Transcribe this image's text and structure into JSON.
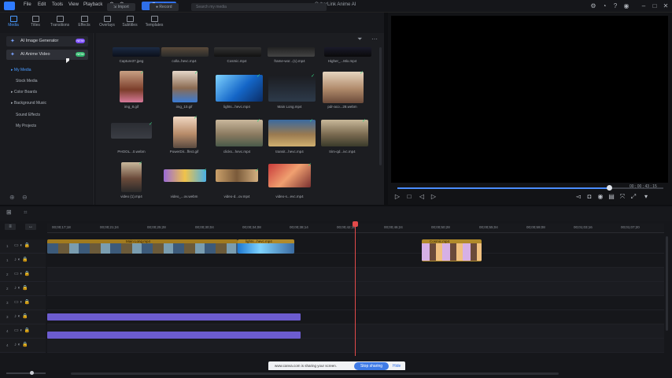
{
  "titlebar": {
    "menu": [
      "File",
      "Edit",
      "Tools",
      "View",
      "Playback"
    ],
    "export_label": "Export",
    "app_title": "CyberLink Anime AI"
  },
  "topnav": {
    "tabs": [
      "Media",
      "Titles",
      "Transitions",
      "Effects",
      "Overlays",
      "Subtitles",
      "Templates"
    ],
    "active": "Media"
  },
  "sidebar": {
    "ai_image_generator": "AI Image Generator",
    "ai_image_badge": "NEW",
    "ai_anime_video": "AI Anime Video",
    "ai_anime_badge": "NEW",
    "items": [
      "My Media",
      "Stock Media",
      "Color Boards",
      "Background Music",
      "Sound Effects",
      "My Projects"
    ],
    "active_item": "My Media"
  },
  "media": {
    "import_label": "Import",
    "record_label": "Record",
    "search_placeholder": "Search my media",
    "rows": [
      [
        {
          "caption": "Capture37.jpeg"
        },
        {
          "caption": "colla..hevc.mp4"
        },
        {
          "caption": "Cosmic.mp4"
        },
        {
          "caption": "frame-wor...(1).mp4"
        },
        {
          "caption": "Higher_...Mix.mp4"
        }
      ],
      [
        {
          "caption": "img_8.gif"
        },
        {
          "caption": "img_10.gif"
        },
        {
          "caption": "lights...hevc.mp4"
        },
        {
          "caption": "Main Long.mp4"
        },
        {
          "caption": "pdr-aco...28.webm"
        }
      ],
      [
        {
          "caption": "PHOOL...0.webm"
        },
        {
          "caption": "PowerDir...ffect.gif"
        },
        {
          "caption": "clicks...hevc.mp4"
        },
        {
          "caption": "transit...hevc.mp4"
        },
        {
          "caption": "trim-qd...ivc.mp4"
        }
      ],
      [
        {
          "caption": "video (1).mp4"
        },
        {
          "caption": "video_...ov.webm"
        },
        {
          "caption": "video-d...ov.mp4"
        },
        {
          "caption": "video-s...evc.mp4"
        }
      ]
    ]
  },
  "preview": {
    "timecode": "00 ; 00 ; 43 ; 15"
  },
  "timeline": {
    "ruler": [
      "00;00;17;18",
      "00;00;21;24",
      "00;00;25;28",
      "00;00;30;04",
      "00;00;34;08",
      "00;00;38;14",
      "00;00;42;16",
      "00;00;46;24",
      "00;00;50;28",
      "00;00;55;04",
      "00;00;59;08",
      "00;01;03;16",
      "00;01;07;20"
    ],
    "tracks": [
      "1",
      "1",
      "2",
      "2",
      "3",
      "3",
      "4",
      "4",
      "5",
      "5"
    ],
    "clips": [
      {
        "label": "Main Long.mp4"
      },
      {
        "label": "lights...hevc.mp4"
      },
      {
        "label": "Cosmic.mp4"
      }
    ]
  },
  "sharing": {
    "text": "www.canva.com is sharing your screen.",
    "stop_label": "Stop sharing",
    "hide_label": "Hide"
  },
  "colors": {
    "accent": "#2f6fe8",
    "video_clip": "#a07a1e",
    "audio_clip": "#6c5ccf",
    "playhead": "#e24a4a"
  }
}
